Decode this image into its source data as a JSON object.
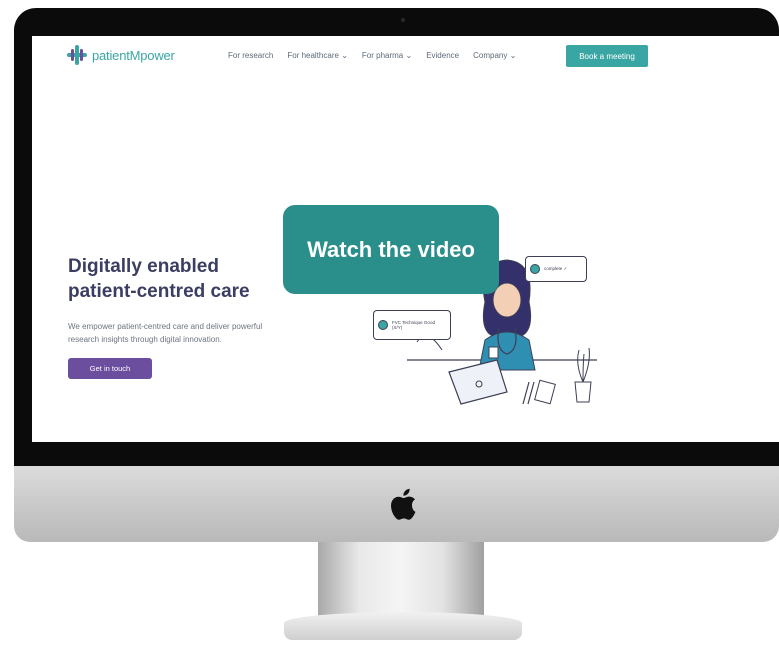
{
  "site": {
    "logo_text": "patientMpower",
    "nav": [
      "For research",
      "For healthcare",
      "For pharma",
      "Evidence",
      "Company"
    ],
    "book_button": "Book a meeting"
  },
  "hero": {
    "title_line1": "Digitally enabled",
    "title_line2": "patient-centred care",
    "subtitle_line1": "We empower patient-centred care and deliver powerful",
    "subtitle_line2": "research insights through digital innovation.",
    "cta": "Get in touch"
  },
  "illustration": {
    "chip_left": "FVC Technique Good (X/Y)",
    "chip_right": "complete ✓"
  },
  "overlay": {
    "watch_label": "Watch the video"
  },
  "colors": {
    "teal": "#3aa6a3",
    "purple": "#6b4f9e",
    "overlay": "#2a8f8a",
    "navy": "#3b3e62"
  }
}
